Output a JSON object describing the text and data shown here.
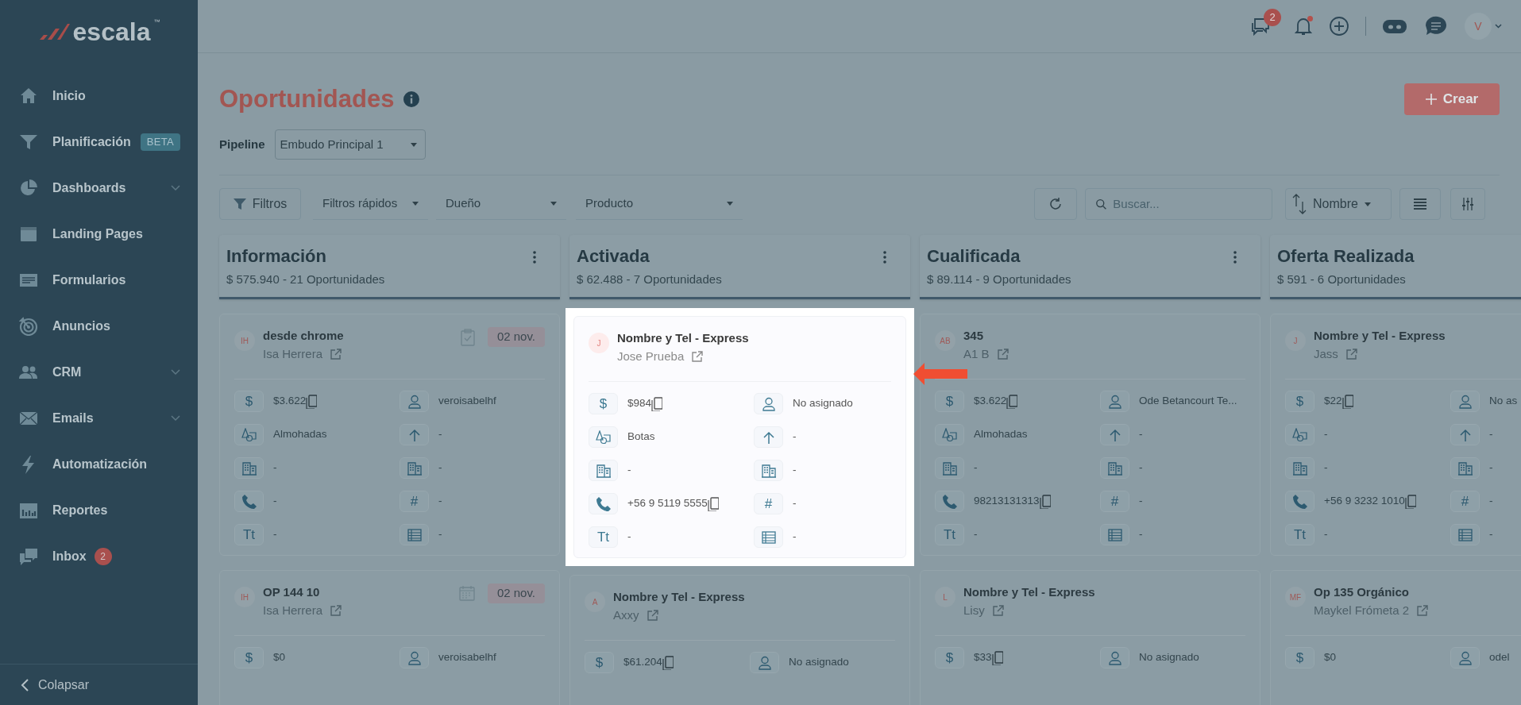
{
  "brand": {
    "name": "escala",
    "mark": "™"
  },
  "header": {
    "chat_badge": "2",
    "bell_dot": true,
    "avatar": "V"
  },
  "sidebar": {
    "items": [
      {
        "label": "Inicio",
        "kind": "home",
        "expandable": false
      },
      {
        "label": "Planificación",
        "kind": "funnel",
        "tag": "BETA",
        "expandable": false
      },
      {
        "label": "Dashboards",
        "kind": "pie",
        "expandable": true
      },
      {
        "label": "Landing Pages",
        "kind": "page",
        "expandable": false
      },
      {
        "label": "Formularios",
        "kind": "form",
        "expandable": false
      },
      {
        "label": "Anuncios",
        "kind": "target",
        "expandable": false
      },
      {
        "label": "CRM",
        "kind": "people",
        "expandable": true
      },
      {
        "label": "Emails",
        "kind": "mail",
        "expandable": true
      },
      {
        "label": "Automatización",
        "kind": "bolt",
        "expandable": false
      },
      {
        "label": "Reportes",
        "kind": "chart",
        "expandable": false
      },
      {
        "label": "Inbox",
        "kind": "inbox",
        "count": "2",
        "expandable": false
      }
    ],
    "collapse": "Colapsar"
  },
  "page": {
    "title": "Oportunidades",
    "create": "Crear"
  },
  "pipeline": {
    "label": "Pipeline",
    "value": "Embudo Principal 1"
  },
  "filters": {
    "filter_button": "Filtros",
    "quick": "Filtros rápidos",
    "owner": "Dueño",
    "product": "Producto",
    "search_placeholder": "Buscar...",
    "sort": "Nombre"
  },
  "columns": [
    {
      "title": "Información",
      "summary": "$ 575.940 - 21 Oportunidades",
      "cards": [
        {
          "initials": "IH",
          "title": "desde chrome",
          "contact": "Isa Herrera",
          "highlighted": false,
          "date": {
            "kind": "task",
            "text": "02 nov."
          },
          "fields": [
            {
              "kind": "glyph",
              "glyph": "$",
              "value": "$3.622",
              "copy": true
            },
            {
              "kind": "user",
              "value": "veroisabelhf",
              "copy": false
            },
            {
              "kind": "product",
              "value": "Almohadas",
              "copy": false
            },
            {
              "kind": "arrow",
              "value": "-",
              "copy": false
            },
            {
              "kind": "building",
              "value": "-",
              "copy": false
            },
            {
              "kind": "building",
              "value": "-",
              "copy": false
            },
            {
              "kind": "phone",
              "value": "-",
              "copy": false
            },
            {
              "kind": "glyph",
              "glyph": "#",
              "value": "-",
              "copy": false
            },
            {
              "kind": "glyph",
              "glyph": "Tt",
              "value": "-",
              "copy": false
            },
            {
              "kind": "table",
              "value": "-",
              "copy": false
            }
          ]
        },
        {
          "initials": "IH",
          "title": "OP 144 10",
          "contact": "Isa Herrera",
          "highlighted": false,
          "date": {
            "kind": "calendar",
            "text": "02 nov."
          },
          "fields": [
            {
              "kind": "glyph",
              "glyph": "$",
              "value": "$0",
              "copy": false
            },
            {
              "kind": "user",
              "value": "veroisabelhf",
              "copy": false
            }
          ]
        }
      ]
    },
    {
      "title": "Activada",
      "summary": "$ 62.488 - 7 Oportunidades",
      "cards": [
        {
          "initials": "J",
          "title": "Nombre y Tel - Express",
          "contact": "Jose Prueba",
          "highlighted": true,
          "fields": [
            {
              "kind": "glyph",
              "glyph": "$",
              "value": "$984",
              "copy": true
            },
            {
              "kind": "user",
              "value": "No asignado",
              "copy": false
            },
            {
              "kind": "product",
              "value": "Botas",
              "copy": false
            },
            {
              "kind": "arrow",
              "value": "-",
              "copy": false
            },
            {
              "kind": "building",
              "value": "-",
              "copy": false
            },
            {
              "kind": "building",
              "value": "-",
              "copy": false
            },
            {
              "kind": "phone",
              "value": "+56 9 5119 5555",
              "copy": true
            },
            {
              "kind": "glyph",
              "glyph": "#",
              "value": "-",
              "copy": false
            },
            {
              "kind": "glyph",
              "glyph": "Tt",
              "value": "-",
              "copy": false
            },
            {
              "kind": "table",
              "value": "-",
              "copy": false
            }
          ]
        },
        {
          "initials": "A",
          "title": "Nombre y Tel - Express",
          "contact": "Axxy",
          "highlighted": false,
          "fields": [
            {
              "kind": "glyph",
              "glyph": "$",
              "value": "$61.204",
              "copy": true
            },
            {
              "kind": "user",
              "value": "No asignado",
              "copy": false
            }
          ]
        }
      ]
    },
    {
      "title": "Cualificada",
      "summary": "$ 89.114 - 9 Oportunidades",
      "cards": [
        {
          "initials": "AB",
          "title": "345",
          "contact": "A1 B",
          "highlighted": false,
          "fields": [
            {
              "kind": "glyph",
              "glyph": "$",
              "value": "$3.622",
              "copy": true
            },
            {
              "kind": "user",
              "value": "Ode Betancourt Te...",
              "copy": false
            },
            {
              "kind": "product",
              "value": "Almohadas",
              "copy": false
            },
            {
              "kind": "arrow",
              "value": "-",
              "copy": false
            },
            {
              "kind": "building",
              "value": "-",
              "copy": false
            },
            {
              "kind": "building",
              "value": "-",
              "copy": false
            },
            {
              "kind": "phone",
              "value": "98213131313",
              "copy": true
            },
            {
              "kind": "glyph",
              "glyph": "#",
              "value": "-",
              "copy": false
            },
            {
              "kind": "glyph",
              "glyph": "Tt",
              "value": "-",
              "copy": false
            },
            {
              "kind": "table",
              "value": "-",
              "copy": false
            }
          ]
        },
        {
          "initials": "L",
          "title": "Nombre y Tel - Express",
          "contact": "Lisy",
          "highlighted": false,
          "fields": [
            {
              "kind": "glyph",
              "glyph": "$",
              "value": "$33",
              "copy": true
            },
            {
              "kind": "user",
              "value": "No asignado",
              "copy": false
            }
          ]
        }
      ]
    },
    {
      "title": "Oferta Realizada",
      "summary": "$ 591 - 6 Oportunidades",
      "cards": [
        {
          "initials": "J",
          "title": "Nombre y Tel - Express",
          "contact": "Jass",
          "highlighted": false,
          "fields": [
            {
              "kind": "glyph",
              "glyph": "$",
              "value": "$22",
              "copy": true
            },
            {
              "kind": "user",
              "value": "No as",
              "copy": false
            },
            {
              "kind": "product",
              "value": "-",
              "copy": false
            },
            {
              "kind": "arrow",
              "value": "-",
              "copy": false
            },
            {
              "kind": "building",
              "value": "-",
              "copy": false
            },
            {
              "kind": "building",
              "value": "-",
              "copy": false
            },
            {
              "kind": "phone",
              "value": "+56 9 3232 1010",
              "copy": true
            },
            {
              "kind": "glyph",
              "glyph": "#",
              "value": "-",
              "copy": false
            },
            {
              "kind": "glyph",
              "glyph": "Tt",
              "value": "-",
              "copy": false
            },
            {
              "kind": "table",
              "value": "-",
              "copy": false
            }
          ]
        },
        {
          "initials": "MF",
          "title": "Op 135 Orgánico",
          "contact": "Maykel Frómeta 2",
          "highlighted": false,
          "fields": [
            {
              "kind": "glyph",
              "glyph": "$",
              "value": "$0",
              "copy": false
            },
            {
              "kind": "user",
              "value": "odel",
              "copy": false
            }
          ]
        }
      ]
    }
  ]
}
